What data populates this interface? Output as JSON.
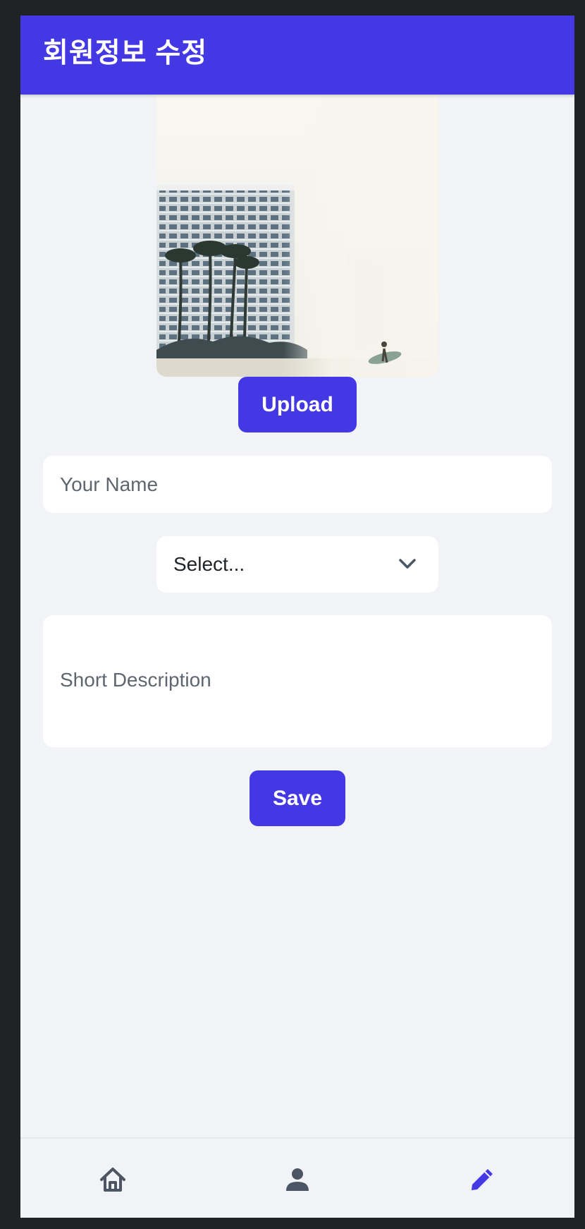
{
  "header": {
    "title": "회원정보 수정",
    "background_color": "#4338e4"
  },
  "profile": {
    "photo_alt": "Beach high-rise with palm trees and a surfer",
    "upload_label": "Upload"
  },
  "form": {
    "name_placeholder": "Your Name",
    "name_value": "",
    "select_value": "Select...",
    "description_placeholder": "Short Description",
    "description_value": "",
    "save_label": "Save"
  },
  "bottom_nav": {
    "items": [
      {
        "icon": "home-icon",
        "active": false
      },
      {
        "icon": "person-icon",
        "active": false
      },
      {
        "icon": "pencil-icon",
        "active": true
      }
    ],
    "active_color": "#4338e4",
    "inactive_color": "#4b5563"
  },
  "colors": {
    "accent": "#4338e4",
    "page_background": "#f2f3f7",
    "field_background": "#ffffff"
  }
}
